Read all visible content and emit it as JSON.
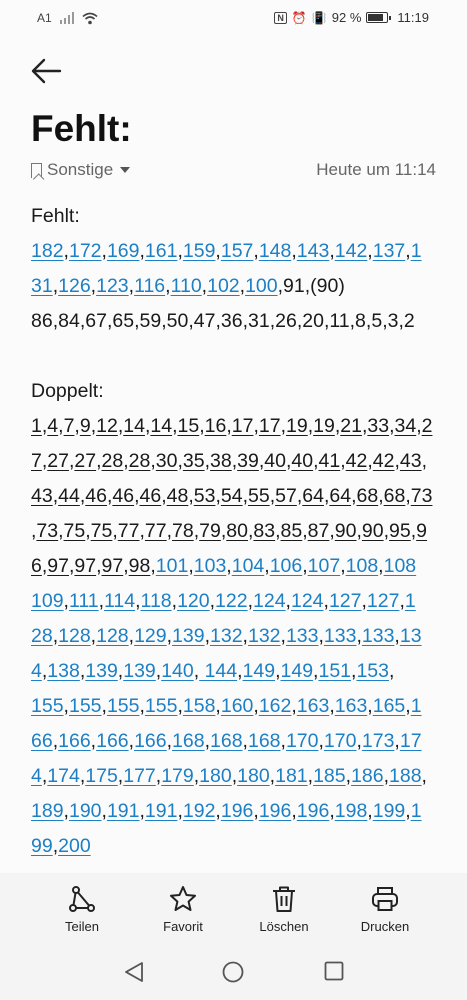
{
  "status": {
    "carrier": "A1",
    "battery": "92 %",
    "time": "11:19"
  },
  "note": {
    "title": "Fehlt:",
    "folder": "Sonstige",
    "timestamp": "Heute um 11:14",
    "missing_label": "Fehlt:",
    "doubles_label": "Doppelt:"
  },
  "missing_lines": [
    [
      [
        "182",
        "l"
      ],
      [
        "172",
        "l"
      ],
      [
        "169",
        "l"
      ],
      [
        "161",
        "l"
      ],
      [
        "159",
        "l"
      ],
      [
        "157",
        "l"
      ],
      [
        "148",
        "l"
      ],
      [
        "143",
        "l"
      ],
      [
        "142",
        "l"
      ],
      [
        "137",
        "l"
      ],
      [
        "1",
        "l"
      ]
    ],
    [
      [
        "31",
        "l"
      ],
      [
        "126",
        "l"
      ],
      [
        "123",
        "l"
      ],
      [
        "116",
        "l"
      ],
      [
        "110",
        "l"
      ],
      [
        "102",
        "l"
      ],
      [
        "100",
        "l"
      ],
      [
        "91",
        "t"
      ],
      [
        "(90)",
        "t"
      ]
    ],
    [
      [
        "86",
        "t"
      ],
      [
        "84",
        "t"
      ],
      [
        "67",
        "t"
      ],
      [
        "65",
        "t"
      ],
      [
        "59",
        "t"
      ],
      [
        "50",
        "t"
      ],
      [
        "47",
        "t"
      ],
      [
        "36",
        "t"
      ],
      [
        "31",
        "t"
      ],
      [
        "26",
        "t"
      ],
      [
        "20",
        "t"
      ],
      [
        "11",
        "t"
      ],
      [
        "8",
        "t"
      ],
      [
        "5",
        "t"
      ],
      [
        "3",
        "t"
      ],
      [
        "2",
        "t"
      ]
    ]
  ],
  "doubles_lines": [
    [
      [
        "1",
        "p"
      ],
      [
        "4",
        "p"
      ],
      [
        "7",
        "p"
      ],
      [
        "9",
        "p"
      ],
      [
        "12",
        "p"
      ],
      [
        "14",
        "p"
      ],
      [
        "14",
        "p"
      ],
      [
        "15",
        "p"
      ],
      [
        "16",
        "p"
      ],
      [
        "17",
        "p"
      ],
      [
        "17",
        "p"
      ],
      [
        "19",
        "p"
      ],
      [
        "19",
        "p"
      ],
      [
        "21",
        "p"
      ],
      [
        "33",
        "p"
      ],
      [
        "34",
        "p"
      ],
      [
        "2",
        "p"
      ]
    ],
    [
      [
        "7",
        "p"
      ],
      [
        "27",
        "p"
      ],
      [
        "27",
        "p"
      ],
      [
        "28",
        "p"
      ],
      [
        "28",
        "p"
      ],
      [
        "30",
        "p"
      ],
      [
        "35",
        "p"
      ],
      [
        "38",
        "p"
      ],
      [
        "39",
        "p"
      ],
      [
        "40",
        "p"
      ],
      [
        "40",
        "p"
      ],
      [
        "41",
        "p"
      ],
      [
        "42",
        "p"
      ],
      [
        "42",
        "p"
      ],
      [
        "43",
        "p"
      ],
      [
        "",
        " "
      ]
    ],
    [
      [
        "43",
        "p"
      ],
      [
        "44",
        "p"
      ],
      [
        "46",
        "p"
      ],
      [
        "46",
        "p"
      ],
      [
        "46",
        "p"
      ],
      [
        "48",
        "p"
      ],
      [
        "53",
        "p"
      ],
      [
        "54",
        "p"
      ],
      [
        "55",
        "p"
      ],
      [
        "57",
        "p"
      ],
      [
        "64",
        "p"
      ],
      [
        "64",
        "p"
      ],
      [
        "68",
        "p"
      ],
      [
        "68",
        "p"
      ],
      [
        "73",
        "p"
      ]
    ],
    [
      [
        "",
        "p"
      ],
      [
        "73",
        "p"
      ],
      [
        "75",
        "p"
      ],
      [
        "75",
        "p"
      ],
      [
        "77",
        "p"
      ],
      [
        "77",
        "p"
      ],
      [
        "78",
        "p"
      ],
      [
        "79",
        "p"
      ],
      [
        "80",
        "p"
      ],
      [
        "83",
        "p"
      ],
      [
        "85",
        "p"
      ],
      [
        "87",
        "p"
      ],
      [
        "90",
        "p"
      ],
      [
        "90",
        "p"
      ],
      [
        "95",
        "p"
      ],
      [
        "9",
        "p"
      ]
    ],
    [
      [
        "6",
        "p"
      ],
      [
        "97",
        "p"
      ],
      [
        "97",
        "p"
      ],
      [
        "97",
        "p"
      ],
      [
        "98",
        "p"
      ],
      [
        "101",
        "l"
      ],
      [
        "103",
        "l"
      ],
      [
        "104",
        "l"
      ],
      [
        "106",
        "l"
      ],
      [
        "107",
        "l"
      ],
      [
        "108",
        "l"
      ],
      [
        "108",
        "l"
      ]
    ],
    [
      [
        "109",
        "l"
      ],
      [
        "111",
        "l"
      ],
      [
        "114",
        "l"
      ],
      [
        "118",
        "l"
      ],
      [
        "120",
        "l"
      ],
      [
        "122",
        "l"
      ],
      [
        "124",
        "l"
      ],
      [
        "124",
        "l"
      ],
      [
        "127",
        "l"
      ],
      [
        "127",
        "l"
      ],
      [
        "1",
        "l"
      ]
    ],
    [
      [
        "28",
        "l"
      ],
      [
        "128",
        "l"
      ],
      [
        "128",
        "l"
      ],
      [
        "129",
        "l"
      ],
      [
        "139",
        "l"
      ],
      [
        "132",
        "l"
      ],
      [
        "132",
        "l"
      ],
      [
        "133",
        "l"
      ],
      [
        "133",
        "l"
      ],
      [
        "133",
        "l"
      ],
      [
        "13",
        "l"
      ]
    ],
    [
      [
        "4",
        "l"
      ],
      [
        "138",
        "l"
      ],
      [
        "139",
        "l"
      ],
      [
        "139",
        "l"
      ],
      [
        "140",
        "l"
      ],
      [
        " 144",
        "l"
      ],
      [
        "149",
        "l"
      ],
      [
        "149",
        "l"
      ],
      [
        "151",
        "l"
      ],
      [
        "153",
        "l"
      ],
      [
        "",
        " "
      ]
    ],
    [
      [
        "155",
        "l"
      ],
      [
        "155",
        "l"
      ],
      [
        "155",
        "l"
      ],
      [
        "155",
        "l"
      ],
      [
        "158",
        "l"
      ],
      [
        "160",
        "l"
      ],
      [
        "162",
        "l"
      ],
      [
        "163",
        "l"
      ],
      [
        "163",
        "l"
      ],
      [
        "165",
        "l"
      ],
      [
        "1",
        "l"
      ]
    ],
    [
      [
        "66",
        "l"
      ],
      [
        "166",
        "l"
      ],
      [
        "166",
        "l"
      ],
      [
        "166",
        "l"
      ],
      [
        "168",
        "l"
      ],
      [
        "168",
        "l"
      ],
      [
        "168",
        "l"
      ],
      [
        "170",
        "l"
      ],
      [
        "170",
        "l"
      ],
      [
        "173",
        "l"
      ],
      [
        "17",
        "l"
      ]
    ],
    [
      [
        "4",
        "l"
      ],
      [
        "174",
        "l"
      ],
      [
        "175",
        "l"
      ],
      [
        "177",
        "l"
      ],
      [
        "179",
        "l"
      ],
      [
        "180",
        "l"
      ],
      [
        "180",
        "l"
      ],
      [
        "181",
        "l"
      ],
      [
        "185",
        "l"
      ],
      [
        "186",
        "l"
      ],
      [
        "188",
        "l"
      ],
      [
        "",
        " "
      ]
    ],
    [
      [
        "189",
        "l"
      ],
      [
        "190",
        "l"
      ],
      [
        "191",
        "l"
      ],
      [
        "191",
        "l"
      ],
      [
        "192",
        "l"
      ],
      [
        "196",
        "l"
      ],
      [
        "196",
        "l"
      ],
      [
        "196",
        "l"
      ],
      [
        "198",
        "l"
      ],
      [
        "199",
        "l"
      ],
      [
        "1",
        "l"
      ]
    ],
    [
      [
        "99",
        "l"
      ],
      [
        "200",
        "l"
      ]
    ]
  ],
  "toolbar": {
    "share": "Teilen",
    "favorite": "Favorit",
    "delete": "Löschen",
    "print": "Drucken"
  },
  "colors": {
    "link": "#1d7fc4",
    "text": "#1a1a1a",
    "background": "#fbfbfb"
  }
}
